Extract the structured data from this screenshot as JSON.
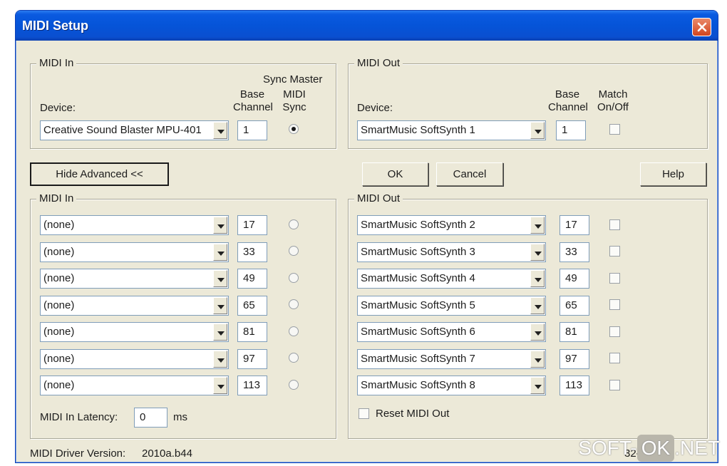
{
  "window": {
    "title": "MIDI Setup"
  },
  "midi_in_basic": {
    "group_title": "MIDI In",
    "device_label": "Device:",
    "base_channel_label": "Base\nChannel",
    "sync_master_label": "Sync Master",
    "midi_sync_label": "MIDI\nSync",
    "device_value": "Creative Sound Blaster MPU-401",
    "channel_value": "1",
    "sync_checked": true
  },
  "midi_out_basic": {
    "group_title": "MIDI Out",
    "device_label": "Device:",
    "base_channel_label": "Base\nChannel",
    "match_label": "Match\nOn/Off",
    "device_value": "SmartMusic SoftSynth 1",
    "channel_value": "1",
    "match_checked": false
  },
  "buttons": {
    "hide_advanced": "Hide Advanced <<",
    "ok": "OK",
    "cancel": "Cancel",
    "help": "Help"
  },
  "midi_in_advanced": {
    "group_title": "MIDI In",
    "rows": [
      {
        "device": "(none)",
        "channel": "17"
      },
      {
        "device": "(none)",
        "channel": "33"
      },
      {
        "device": "(none)",
        "channel": "49"
      },
      {
        "device": "(none)",
        "channel": "65"
      },
      {
        "device": "(none)",
        "channel": "81"
      },
      {
        "device": "(none)",
        "channel": "97"
      },
      {
        "device": "(none)",
        "channel": "113"
      }
    ],
    "latency_label": "MIDI In Latency:",
    "latency_value": "0",
    "latency_unit": "ms"
  },
  "midi_out_advanced": {
    "group_title": "MIDI Out",
    "rows": [
      {
        "device": "SmartMusic SoftSynth 2",
        "channel": "17"
      },
      {
        "device": "SmartMusic SoftSynth 3",
        "channel": "33"
      },
      {
        "device": "SmartMusic SoftSynth 4",
        "channel": "49"
      },
      {
        "device": "SmartMusic SoftSynth 5",
        "channel": "65"
      },
      {
        "device": "SmartMusic SoftSynth 6",
        "channel": "81"
      },
      {
        "device": "SmartMusic SoftSynth 7",
        "channel": "97"
      },
      {
        "device": "SmartMusic SoftSynth 8",
        "channel": "113"
      }
    ],
    "reset_label": "Reset MIDI Out"
  },
  "footer": {
    "driver_label": "MIDI Driver Version:",
    "driver_value": "2010a.b44",
    "bits_value": "32-bit"
  },
  "watermark": {
    "left": "SOFT-",
    "ok": "OK",
    "right": ".NET"
  }
}
